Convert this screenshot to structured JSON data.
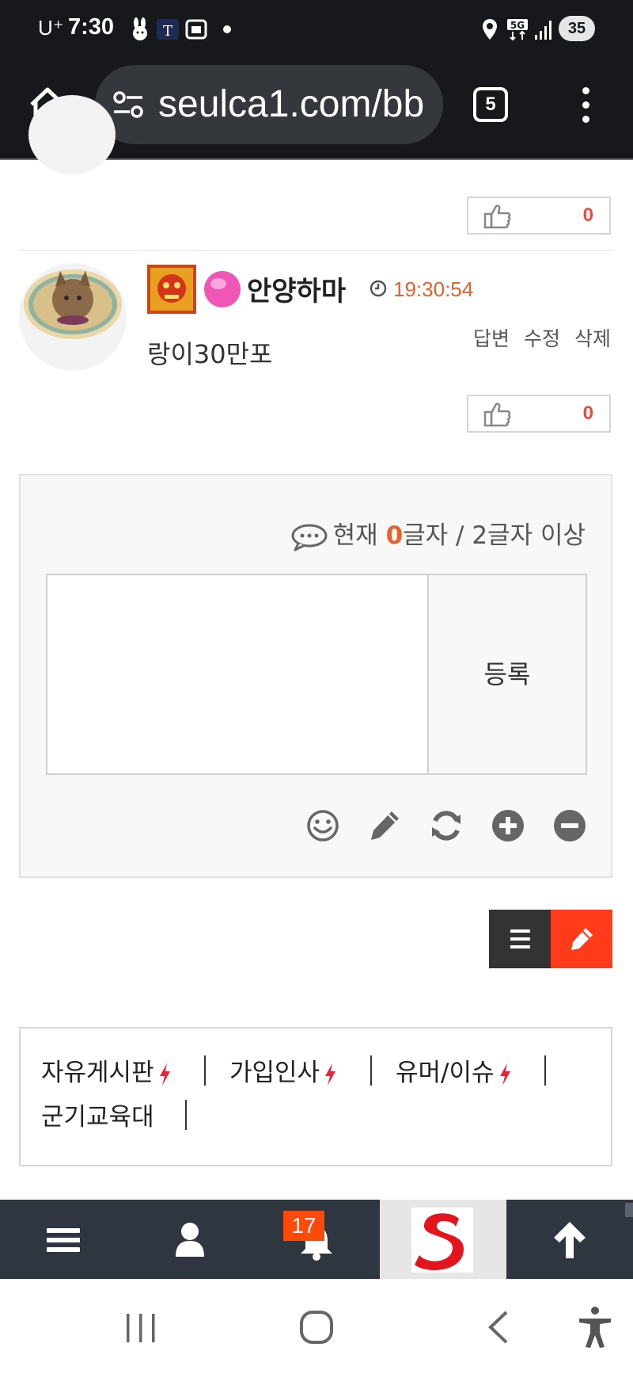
{
  "status_bar": {
    "carrier": "U⁺",
    "time": "7:30",
    "battery": "35",
    "network": "5G"
  },
  "browser": {
    "url": "seulca1.com/bb",
    "tab_count": "5"
  },
  "previous_comment": {
    "likes": "0"
  },
  "comment": {
    "nickname": "안양하마",
    "time": "19:30:54",
    "actions": {
      "reply": "답변",
      "edit": "수정",
      "delete": "삭제"
    },
    "text": "랑이30만포",
    "likes": "0"
  },
  "comment_form": {
    "counter_prefix": "현재 ",
    "counter_value": "0",
    "counter_suffix": "글자 / 2글자 이상",
    "submit_label": "등록",
    "input_value": ""
  },
  "boards": {
    "items": [
      {
        "label": "자유게시판",
        "new": true
      },
      {
        "label": "가입인사",
        "new": true
      },
      {
        "label": "유머/이슈",
        "new": true
      },
      {
        "label": "군기교육대",
        "new": false
      }
    ]
  },
  "bottom_nav": {
    "notification_count": "17"
  },
  "colors": {
    "accent_orange": "#e8602c",
    "write_button": "#ff3b1a",
    "nav_bg": "#2f3640",
    "like_count": "#e74c3c"
  },
  "icons": [
    "home-icon",
    "tune-icon",
    "more-icon",
    "thumbs-up-icon",
    "clock-icon",
    "chat-icon",
    "smile-icon",
    "pencil-icon",
    "refresh-icon",
    "plus-circle-icon",
    "minus-circle-icon",
    "list-icon",
    "bolt-icon",
    "user-icon",
    "bell-icon",
    "arrow-up-icon",
    "recents-icon",
    "home-circle-icon",
    "back-icon",
    "accessibility-icon"
  ]
}
